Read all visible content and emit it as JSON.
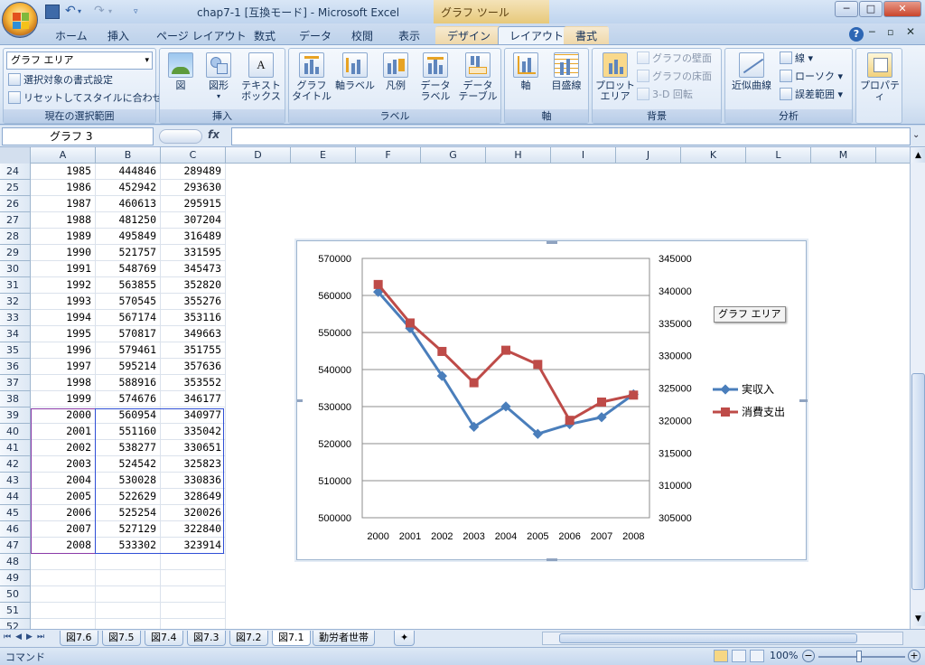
{
  "window": {
    "doc_title": "chap7-1 [互換モード] - Microsoft Excel",
    "tool_title": "グラフ ツール",
    "min": "─",
    "max": "□",
    "close": "✕"
  },
  "tabs": [
    {
      "label": "ホーム"
    },
    {
      "label": "挿入"
    },
    {
      "label": "ページ レイアウト"
    },
    {
      "label": "数式"
    },
    {
      "label": "データ"
    },
    {
      "label": "校閲"
    },
    {
      "label": "表示"
    },
    {
      "label": "デザイン"
    },
    {
      "label": "レイアウト"
    },
    {
      "label": "書式"
    }
  ],
  "ribbon": {
    "selection": {
      "dropdown": "グラフ エリア",
      "format_selection": "選択対象の書式設定",
      "reset_style": "リセットしてスタイルに合わせる",
      "group": "現在の選択範囲"
    },
    "insert": {
      "picture": "図",
      "shapes": "図形",
      "textbox1": "テキスト",
      "textbox2": "ボックス",
      "group": "挿入"
    },
    "labels": {
      "chart_title1": "グラフ",
      "chart_title2": "タイトル",
      "axis_titles": "軸ラベル",
      "legend": "凡例",
      "data_labels1": "データ",
      "data_labels2": "ラベル",
      "data_table1": "データ",
      "data_table2": "テーブル",
      "group": "ラベル"
    },
    "axes": {
      "axes": "軸",
      "gridlines": "目盛線",
      "group": "軸"
    },
    "background": {
      "plot_area1": "プロット",
      "plot_area2": "エリア",
      "chart_wall": "グラフの壁面",
      "chart_floor": "グラフの床面",
      "rotation": "3-D 回転",
      "group": "背景"
    },
    "analysis": {
      "trendline": "近似曲線",
      "lines": "線",
      "updown": "ローソク",
      "error_bars": "誤差範囲",
      "group": "分析"
    },
    "properties": {
      "label": "プロパティ"
    }
  },
  "formula_bar": {
    "name_box": "グラフ 3",
    "fx": "fx",
    "formula": ""
  },
  "columns": [
    "A",
    "B",
    "C",
    "D",
    "E",
    "F",
    "G",
    "H",
    "I",
    "J",
    "K",
    "L",
    "M"
  ],
  "rows": [
    {
      "n": "24",
      "a": "1985",
      "b": "444846",
      "c": "289489"
    },
    {
      "n": "25",
      "a": "1986",
      "b": "452942",
      "c": "293630"
    },
    {
      "n": "26",
      "a": "1987",
      "b": "460613",
      "c": "295915"
    },
    {
      "n": "27",
      "a": "1988",
      "b": "481250",
      "c": "307204"
    },
    {
      "n": "28",
      "a": "1989",
      "b": "495849",
      "c": "316489"
    },
    {
      "n": "29",
      "a": "1990",
      "b": "521757",
      "c": "331595"
    },
    {
      "n": "30",
      "a": "1991",
      "b": "548769",
      "c": "345473"
    },
    {
      "n": "31",
      "a": "1992",
      "b": "563855",
      "c": "352820"
    },
    {
      "n": "32",
      "a": "1993",
      "b": "570545",
      "c": "355276"
    },
    {
      "n": "33",
      "a": "1994",
      "b": "567174",
      "c": "353116"
    },
    {
      "n": "34",
      "a": "1995",
      "b": "570817",
      "c": "349663"
    },
    {
      "n": "35",
      "a": "1996",
      "b": "579461",
      "c": "351755"
    },
    {
      "n": "36",
      "a": "1997",
      "b": "595214",
      "c": "357636"
    },
    {
      "n": "37",
      "a": "1998",
      "b": "588916",
      "c": "353552"
    },
    {
      "n": "38",
      "a": "1999",
      "b": "574676",
      "c": "346177"
    },
    {
      "n": "39",
      "a": "2000",
      "b": "560954",
      "c": "340977"
    },
    {
      "n": "40",
      "a": "2001",
      "b": "551160",
      "c": "335042"
    },
    {
      "n": "41",
      "a": "2002",
      "b": "538277",
      "c": "330651"
    },
    {
      "n": "42",
      "a": "2003",
      "b": "524542",
      "c": "325823"
    },
    {
      "n": "43",
      "a": "2004",
      "b": "530028",
      "c": "330836"
    },
    {
      "n": "44",
      "a": "2005",
      "b": "522629",
      "c": "328649"
    },
    {
      "n": "45",
      "a": "2006",
      "b": "525254",
      "c": "320026"
    },
    {
      "n": "46",
      "a": "2007",
      "b": "527129",
      "c": "322840"
    },
    {
      "n": "47",
      "a": "2008",
      "b": "533302",
      "c": "323914"
    },
    {
      "n": "48",
      "a": "",
      "b": "",
      "c": ""
    },
    {
      "n": "49",
      "a": "",
      "b": "",
      "c": ""
    },
    {
      "n": "50",
      "a": "",
      "b": "",
      "c": ""
    },
    {
      "n": "51",
      "a": "",
      "b": "",
      "c": ""
    },
    {
      "n": "52",
      "a": "",
      "b": "",
      "c": ""
    }
  ],
  "chart_tooltip": "グラフ エリア",
  "chart_data": {
    "type": "line",
    "categories": [
      "2000",
      "2001",
      "2002",
      "2003",
      "2004",
      "2005",
      "2006",
      "2007",
      "2008"
    ],
    "series": [
      {
        "name": "実収入",
        "axis": "left",
        "color": "#4a7ebb",
        "marker": "diamond",
        "values": [
          560954,
          551160,
          538277,
          524542,
          530028,
          522629,
          525254,
          527129,
          533302
        ]
      },
      {
        "name": "消費支出",
        "axis": "right",
        "color": "#be4b48",
        "marker": "square",
        "values": [
          340977,
          335042,
          330651,
          325823,
          330836,
          328649,
          320026,
          322840,
          323914
        ]
      }
    ],
    "ylim_left": [
      500000,
      570000
    ],
    "yticks_left": [
      "570000",
      "560000",
      "550000",
      "540000",
      "530000",
      "520000",
      "510000",
      "500000"
    ],
    "ylim_right": [
      305000,
      345000
    ],
    "yticks_right": [
      "345000",
      "340000",
      "335000",
      "330000",
      "325000",
      "320000",
      "315000",
      "310000",
      "305000"
    ],
    "grid": "horizontal",
    "legend": "right"
  },
  "sheets": [
    {
      "label": "図7.6"
    },
    {
      "label": "図7.5"
    },
    {
      "label": "図7.4"
    },
    {
      "label": "図7.3"
    },
    {
      "label": "図7.2"
    },
    {
      "label": "図7.1"
    },
    {
      "label": "勤労者世帯"
    }
  ],
  "status": {
    "mode": "コマンド",
    "zoom": "100%"
  }
}
